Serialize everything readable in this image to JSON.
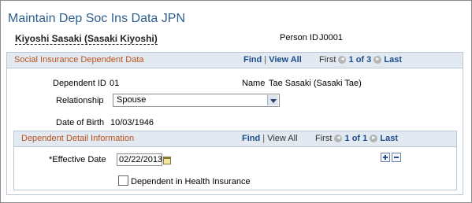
{
  "page": {
    "title": "Maintain Dep Soc Ins Data JPN",
    "employee_name": "Kiyoshi Sasaki (Sasaki Kiyoshi)",
    "person_id_label": "Person ID",
    "person_id": "J0001"
  },
  "sections": {
    "social": {
      "title": "Social Insurance Dependent Data",
      "find": "Find",
      "view_all": "View All",
      "first": "First",
      "counter": "1 of 3",
      "last": "Last"
    },
    "detail": {
      "title": "Dependent Detail Information",
      "find": "Find",
      "view_all": "View All",
      "first": "First",
      "counter": "1 of 1",
      "last": "Last"
    }
  },
  "separator": "|",
  "fields": {
    "dependent_id_label": "Dependent ID",
    "dependent_id": "01",
    "name_label": "Name",
    "name": "Tae Sasaki (Sasaki Tae)",
    "relationship_label": "Relationship",
    "relationship": "Spouse",
    "dob_label": "Date of Birth",
    "dob": "10/03/1946",
    "effective_date_label": "*Effective Date",
    "effective_date": "02/22/2013",
    "health_insurance_label": "Dependent in Health Insurance",
    "health_insurance_checked": false
  },
  "icons": {
    "prev": "left-arrow-icon",
    "next": "right-arrow-icon",
    "calendar": "calendar-icon",
    "add": "plus-icon",
    "delete": "minus-icon"
  },
  "glyphs": {
    "prev": "◄",
    "next": "►"
  }
}
